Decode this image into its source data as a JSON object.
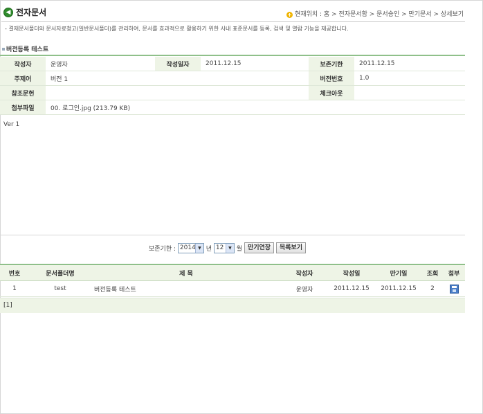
{
  "header": {
    "title": "전자문서",
    "breadcrumb_label": "현재위치 :",
    "breadcrumb": "홈 > 전자문서함 > 문서승인 > 만기문서 > 상세보기"
  },
  "description": "- 결재문서폴더와 문서자료청고(일반문서폴더)를 관리하여, 문서를 효과적으로 활용하기 위한 사내 표준문서를 등록, 검색 및 열람 기능을 제공합니다.",
  "section_title": "버전등록 테스트",
  "info": {
    "author_label": "작성자",
    "author": "운영자",
    "date_label": "작성일자",
    "date": "2011.12.15",
    "retention_label": "보존기한",
    "retention": "2011.12.15",
    "subject_label": "주제어",
    "subject": "버전 1",
    "version_label": "버전번호",
    "version": "1.0",
    "ref_label": "참조문헌",
    "ref": "",
    "checkout_label": "체크아웃",
    "checkout": "",
    "attach_label": "첨부파일",
    "attach": "00. 로그인.jpg (213.79 KB)"
  },
  "body_text": "Ver 1",
  "extend": {
    "label": "보존기한 :",
    "year": "2014",
    "year_unit": "년",
    "month": "12",
    "month_unit": "월",
    "extend_button": "만기연장",
    "list_button": "목록보기"
  },
  "list": {
    "headers": [
      "번호",
      "문서폴더명",
      "제 목",
      "작성자",
      "작성일",
      "만기일",
      "조회",
      "첨부"
    ],
    "rows": [
      {
        "no": "1",
        "folder": "test",
        "title": "버전등록 테스트",
        "author": "운영자",
        "created": "2011.12.15",
        "expires": "2011.12.15",
        "views": "2",
        "attach_icon": "floppy-disk-icon"
      }
    ]
  },
  "pager": "[1]"
}
